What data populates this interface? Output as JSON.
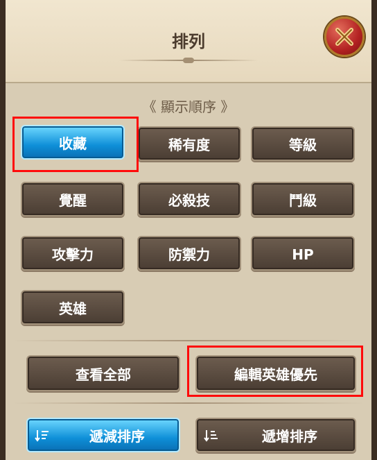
{
  "title": "排列",
  "section_label": "《 顯示順序 》",
  "sort_buttons": [
    "收藏",
    "稀有度",
    "等級",
    "覺醒",
    "必殺技",
    "鬥級",
    "攻擊力",
    "防禦力",
    "HP",
    "英雄"
  ],
  "actions": {
    "view_all": "查看全部",
    "edit_hero_priority": "編輯英雄優先"
  },
  "order": {
    "descending": "遞減排序",
    "ascending": "遞增排序"
  },
  "selected": "收藏",
  "colors": {
    "active_button": "#0e8fd8",
    "highlight_box": "#ff0a0a",
    "close_button": "#b32222"
  }
}
